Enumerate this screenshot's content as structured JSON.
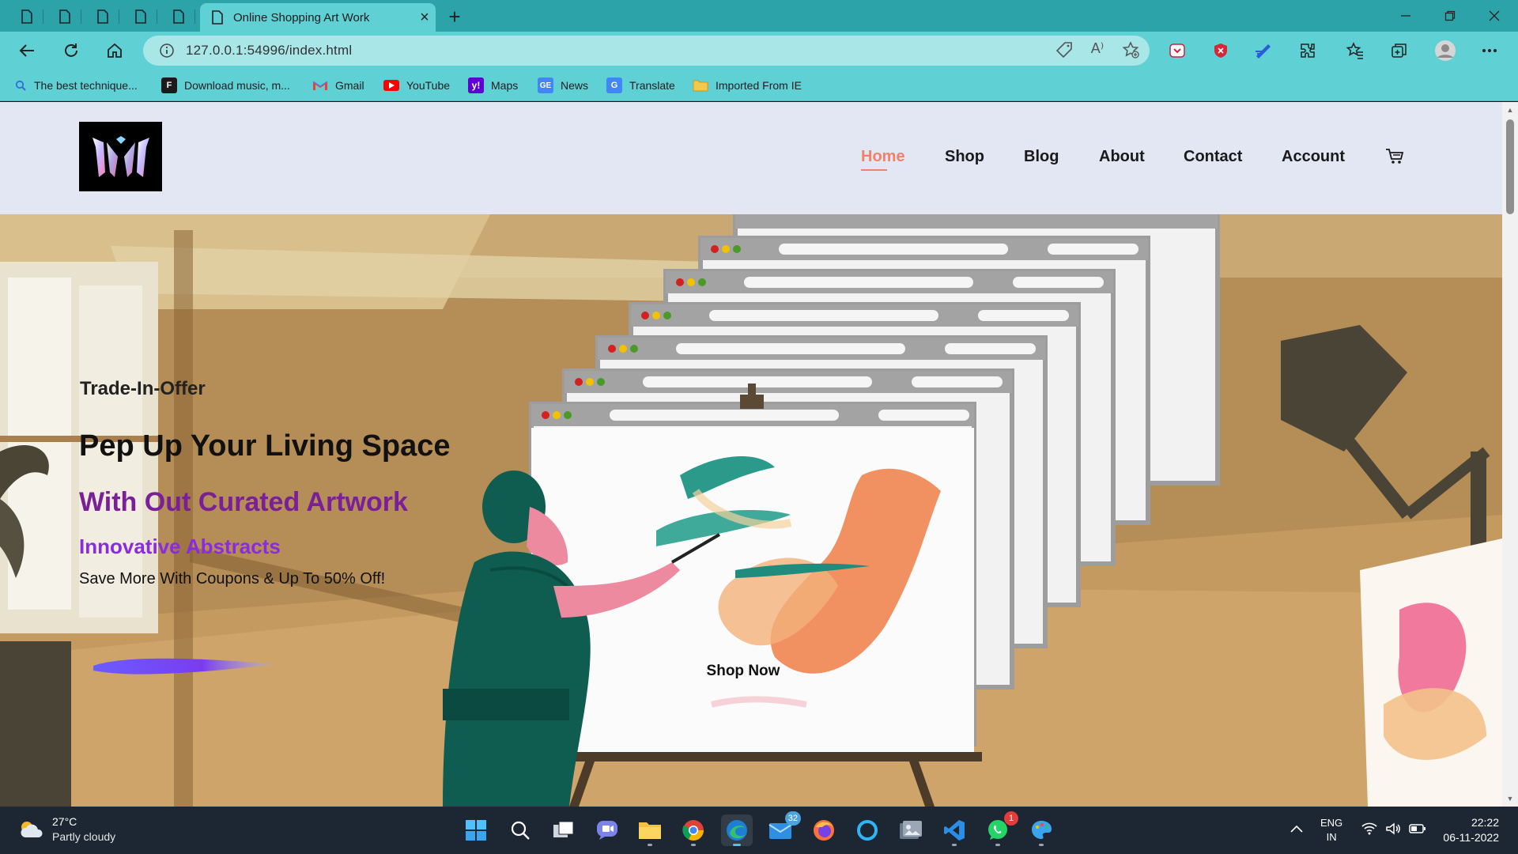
{
  "browser": {
    "tab_title": "Online Shopping Art Work",
    "close_tab": "×",
    "new_tab": "+",
    "url": "127.0.0.1:54996/index.html",
    "read_aloud": "A⁾"
  },
  "bookmarks": [
    {
      "label": "The best technique...",
      "icon": "search-icon"
    },
    {
      "label": "Download music, m...",
      "icon": "f-logo-icon"
    },
    {
      "label": "Gmail",
      "icon": "gmail-icon"
    },
    {
      "label": "YouTube",
      "icon": "youtube-icon"
    },
    {
      "label": "Maps",
      "icon": "yahoo-icon"
    },
    {
      "label": "News",
      "icon": "news-icon"
    },
    {
      "label": "Translate",
      "icon": "translate-icon"
    },
    {
      "label": "Imported From IE",
      "icon": "folder-icon"
    }
  ],
  "site": {
    "nav": [
      {
        "label": "Home",
        "active": true
      },
      {
        "label": "Shop"
      },
      {
        "label": "Blog"
      },
      {
        "label": "About"
      },
      {
        "label": "Contact"
      },
      {
        "label": "Account"
      }
    ],
    "cart_icon": "cart-icon",
    "logo_icon": "logo-icon"
  },
  "hero": {
    "kicker": "Trade-In-Offer",
    "title": "Pep Up Your Living Space",
    "headline": "With Out Curated Artwork",
    "subheadline": "Innovative Abstracts",
    "description": "Save More With Coupons & Up To 50% Off!",
    "button": "Shop Now"
  },
  "taskbar": {
    "weather_temp": "27°C",
    "weather_desc": "Partly cloudy",
    "mail_badge": "32",
    "whatsapp_badge": "1",
    "lang_top": "ENG",
    "lang_bottom": "IN",
    "time": "22:22",
    "date": "06-11-2022"
  },
  "colors": {
    "accent": "#f0826b",
    "headline": "#7a1f98",
    "subheadline": "#8a2be2",
    "chrome": "#5fd0d4"
  }
}
